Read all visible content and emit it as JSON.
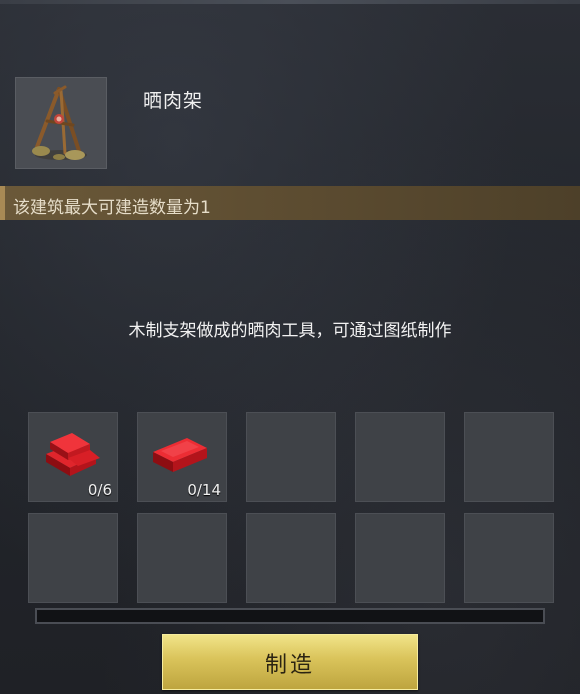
{
  "item": {
    "name": "晒肉架",
    "icon": "meat-drying-rack-icon"
  },
  "limit_text": "该建筑最大可建造数量为1",
  "description": "木制支架做成的晒肉工具，可通过图纸制作",
  "materials": [
    {
      "icon": "red-ingot-stack-icon",
      "count": "0/6"
    },
    {
      "icon": "red-ingot-icon",
      "count": "0/14"
    }
  ],
  "empty_slot_count": 8,
  "progress": 0,
  "craft_button_label": "制造",
  "colors": {
    "accent_gold": "#d9c35a",
    "limit_bar": "#6b5939",
    "material_red": "#c8141a"
  }
}
